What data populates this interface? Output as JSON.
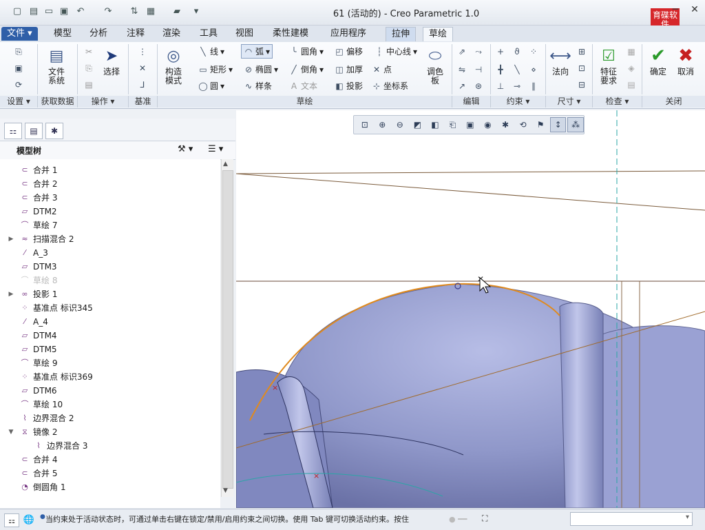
{
  "window": {
    "title": "61 (活动的) - Creo Parametric 1.0",
    "logo_text": "育碟软件"
  },
  "tabs": [
    {
      "label": "文件"
    },
    {
      "label": "模型"
    },
    {
      "label": "分析"
    },
    {
      "label": "注释"
    },
    {
      "label": "渲染"
    },
    {
      "label": "工具"
    },
    {
      "label": "视图"
    },
    {
      "label": "柔性建模"
    },
    {
      "label": "应用程序"
    },
    {
      "label": "拉伸"
    },
    {
      "label": "草绘"
    }
  ],
  "ribbon": {
    "file_system": "文件\n系统",
    "select": "选择",
    "construct_mode": "构造\n模式",
    "line": "线",
    "arc": "弧",
    "rectangle": "矩形",
    "ellipse": "椭圆",
    "circle": "圆",
    "spline": "样条",
    "fillet": "圆角",
    "chamfer": "倒角",
    "text": "文本",
    "offset": "偏移",
    "thicken": "加厚",
    "project": "投影",
    "centerline": "中心线",
    "point": "点",
    "coord_sys": "坐标系",
    "palette": "调色\n板",
    "normal": "法向",
    "feature_req": "特征\n要求",
    "ok": "确定",
    "cancel": "取消",
    "groups": {
      "setup": "设置",
      "get_data": "获取数据",
      "operations": "操作",
      "datum": "基准",
      "sketch": "草绘",
      "edit": "编辑",
      "constrain": "约束",
      "dimension": "尺寸",
      "inspect": "检查",
      "close": "关闭"
    }
  },
  "model_tree": {
    "title": "模型树",
    "items": [
      {
        "label": "合并 1",
        "icon": "merge-icon"
      },
      {
        "label": "合并 2",
        "icon": "merge-icon"
      },
      {
        "label": "合并 3",
        "icon": "merge-icon"
      },
      {
        "label": "DTM2",
        "icon": "datum-plane-icon"
      },
      {
        "label": "草绘 7",
        "icon": "sketch-icon"
      },
      {
        "label": "扫描混合 2",
        "icon": "sweep-blend-icon",
        "expandable": true
      },
      {
        "label": "A_3",
        "icon": "axis-icon"
      },
      {
        "label": "DTM3",
        "icon": "datum-plane-icon"
      },
      {
        "label": "草绘 8",
        "icon": "sketch-icon",
        "dim": true
      },
      {
        "label": "投影 1",
        "icon": "projection-icon",
        "expandable": true
      },
      {
        "label": "基准点 标识345",
        "icon": "datum-point-icon"
      },
      {
        "label": "A_4",
        "icon": "axis-icon"
      },
      {
        "label": "DTM4",
        "icon": "datum-plane-icon"
      },
      {
        "label": "DTM5",
        "icon": "datum-plane-icon"
      },
      {
        "label": "草绘 9",
        "icon": "sketch-icon"
      },
      {
        "label": "基准点 标识369",
        "icon": "datum-point-icon"
      },
      {
        "label": "DTM6",
        "icon": "datum-plane-icon"
      },
      {
        "label": "草绘 10",
        "icon": "sketch-icon"
      },
      {
        "label": "边界混合 2",
        "icon": "boundary-blend-icon"
      },
      {
        "label": "镜像 2",
        "icon": "mirror-icon",
        "expanded": true
      },
      {
        "label": "边界混合 3",
        "icon": "boundary-blend-icon",
        "child": true
      },
      {
        "label": "合并 4",
        "icon": "merge-icon"
      },
      {
        "label": "合并 5",
        "icon": "merge-icon"
      },
      {
        "label": "倒圆角 1",
        "icon": "round-icon"
      }
    ]
  },
  "status": {
    "message": "当约束处于活动状态时，可通过单击右键在锁定/禁用/启用约束之间切换。使用 Tab 键可切换活动约束。按住"
  },
  "colors": {
    "accent": "#2f5fa8",
    "model_surface": "#8f97c9",
    "sketch_orange": "#e08a1e",
    "ok_green": "#2a9a2a",
    "cancel_red": "#c62020"
  }
}
